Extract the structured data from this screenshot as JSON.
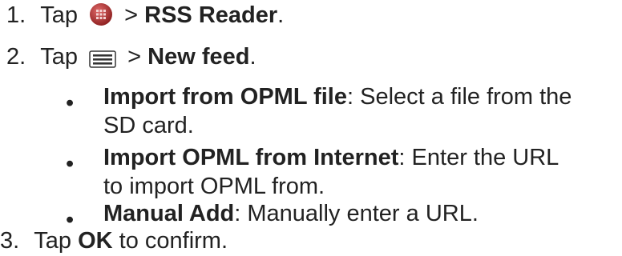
{
  "steps": [
    {
      "number": "1.",
      "pre": "Tap",
      "sep": ">",
      "bold": "RSS Reader",
      "post": ".",
      "icon": "app-grid-icon"
    },
    {
      "number": "2.",
      "pre": "Tap",
      "sep": ">",
      "bold": "New feed",
      "post": ".",
      "icon": "menu-icon"
    },
    {
      "number": "3.",
      "pre": "Tap",
      "bold": "OK",
      "post": "to confirm."
    }
  ],
  "options": [
    {
      "bullet": "•",
      "bold": "Import from OPML file",
      "text": ": Select a file from the",
      "text2": "SD card."
    },
    {
      "bullet": "•",
      "bold": "Import OPML from Internet",
      "text": ": Enter the URL",
      "text2": "to import OPML from."
    },
    {
      "bullet": "•",
      "bold": "Manual Add",
      "text": ": Manually enter a URL."
    }
  ],
  "colors": {
    "text": "#222222",
    "app_icon": "#b03030"
  }
}
